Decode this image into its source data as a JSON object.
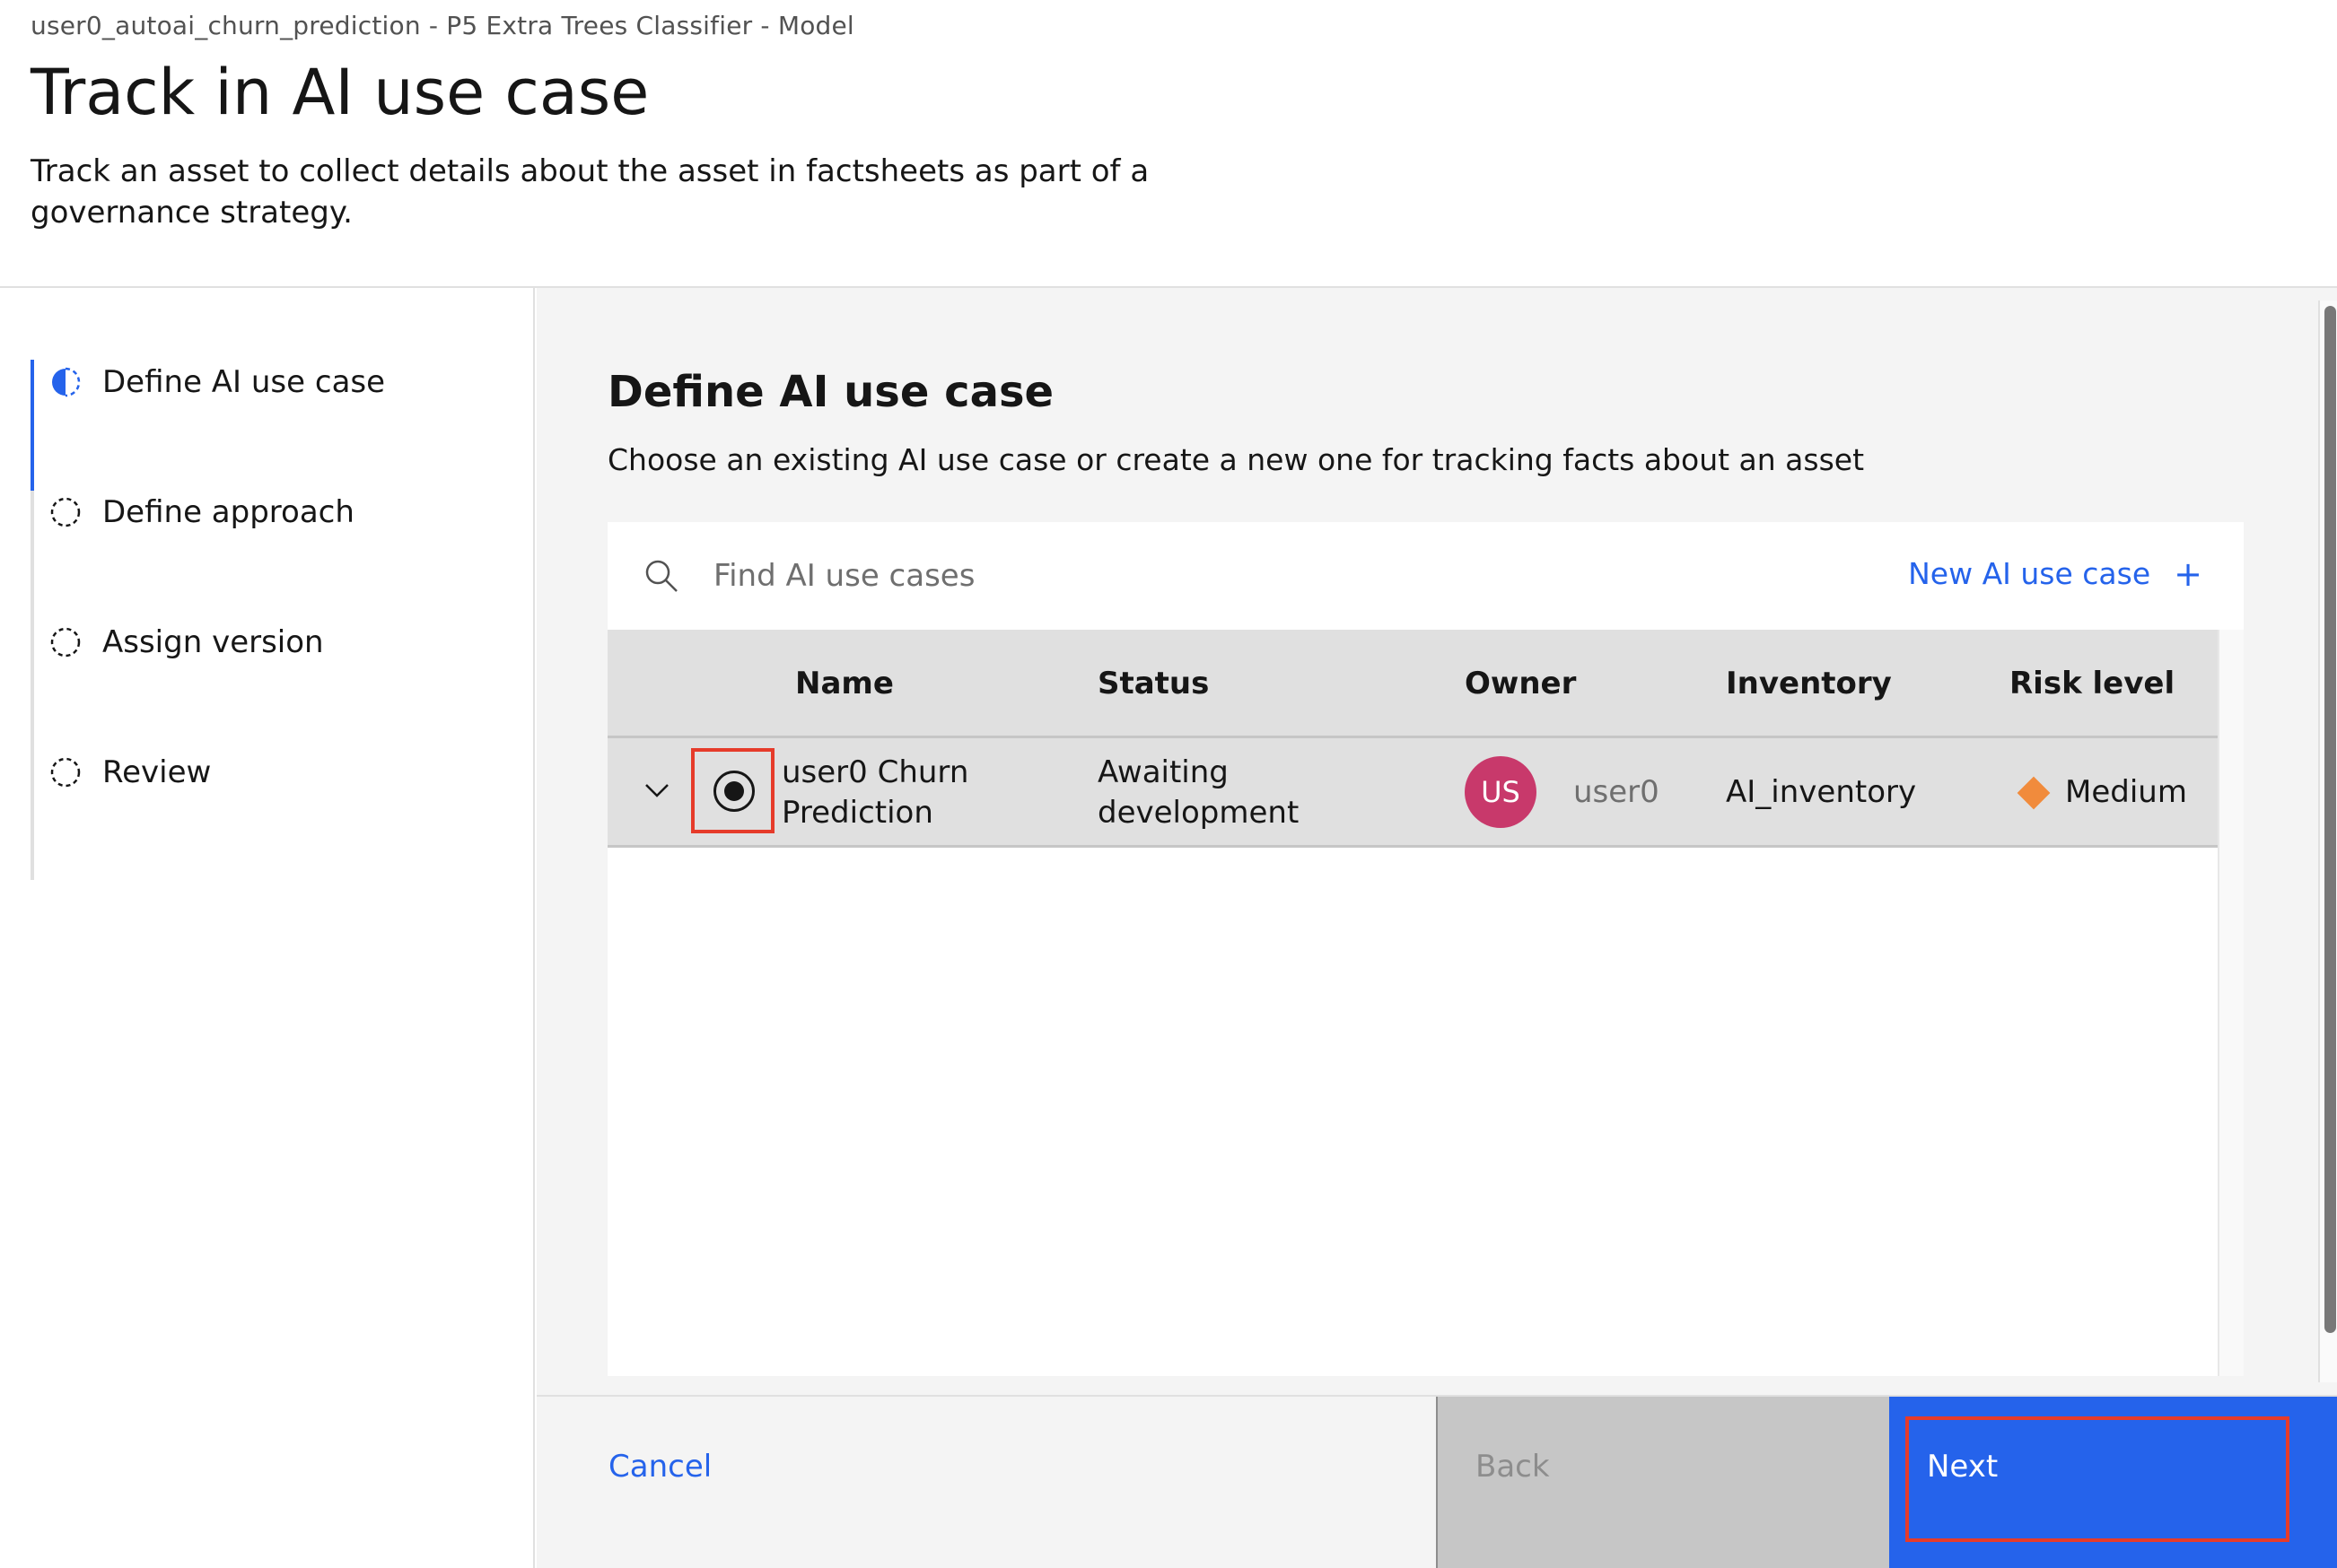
{
  "header": {
    "breadcrumb": "user0_autoai_churn_prediction - P5 Extra Trees Classifier - Model",
    "title": "Track in AI use case",
    "description": "Track an asset to collect details about the asset in factsheets as part of a governance strategy."
  },
  "steps": [
    {
      "label": "Define AI use case",
      "state": "current",
      "icon": "half-filled-circle-icon"
    },
    {
      "label": "Define approach",
      "state": "incomplete",
      "icon": "dashed-circle-icon"
    },
    {
      "label": "Assign version",
      "state": "incomplete",
      "icon": "dashed-circle-icon"
    },
    {
      "label": "Review",
      "state": "incomplete",
      "icon": "dashed-circle-icon"
    }
  ],
  "main": {
    "title": "Define AI use case",
    "subtitle": "Choose an existing AI use case or create a new one for tracking facts about an asset",
    "search": {
      "placeholder": "Find AI use cases",
      "value": "",
      "icon": "search-icon"
    },
    "new_use_case": {
      "label": "New AI use case",
      "icon": "plus-icon"
    }
  },
  "table": {
    "columns": [
      "Name",
      "Status",
      "Owner",
      "Inventory",
      "Risk level"
    ],
    "rows": [
      {
        "selected": true,
        "name_line1": "user0 Churn",
        "name_line2": "Prediction",
        "status_line1": "Awaiting",
        "status_line2": "development",
        "owner_initials": "US",
        "owner": "user0",
        "inventory": "AI_inventory",
        "risk_level": "Medium",
        "risk_color": "#f18b3c"
      }
    ]
  },
  "footer": {
    "cancel": "Cancel",
    "back": "Back",
    "next": "Next"
  },
  "colors": {
    "accent": "#2563eb",
    "highlight": "#e63b2a",
    "avatar": "#c8396b"
  }
}
